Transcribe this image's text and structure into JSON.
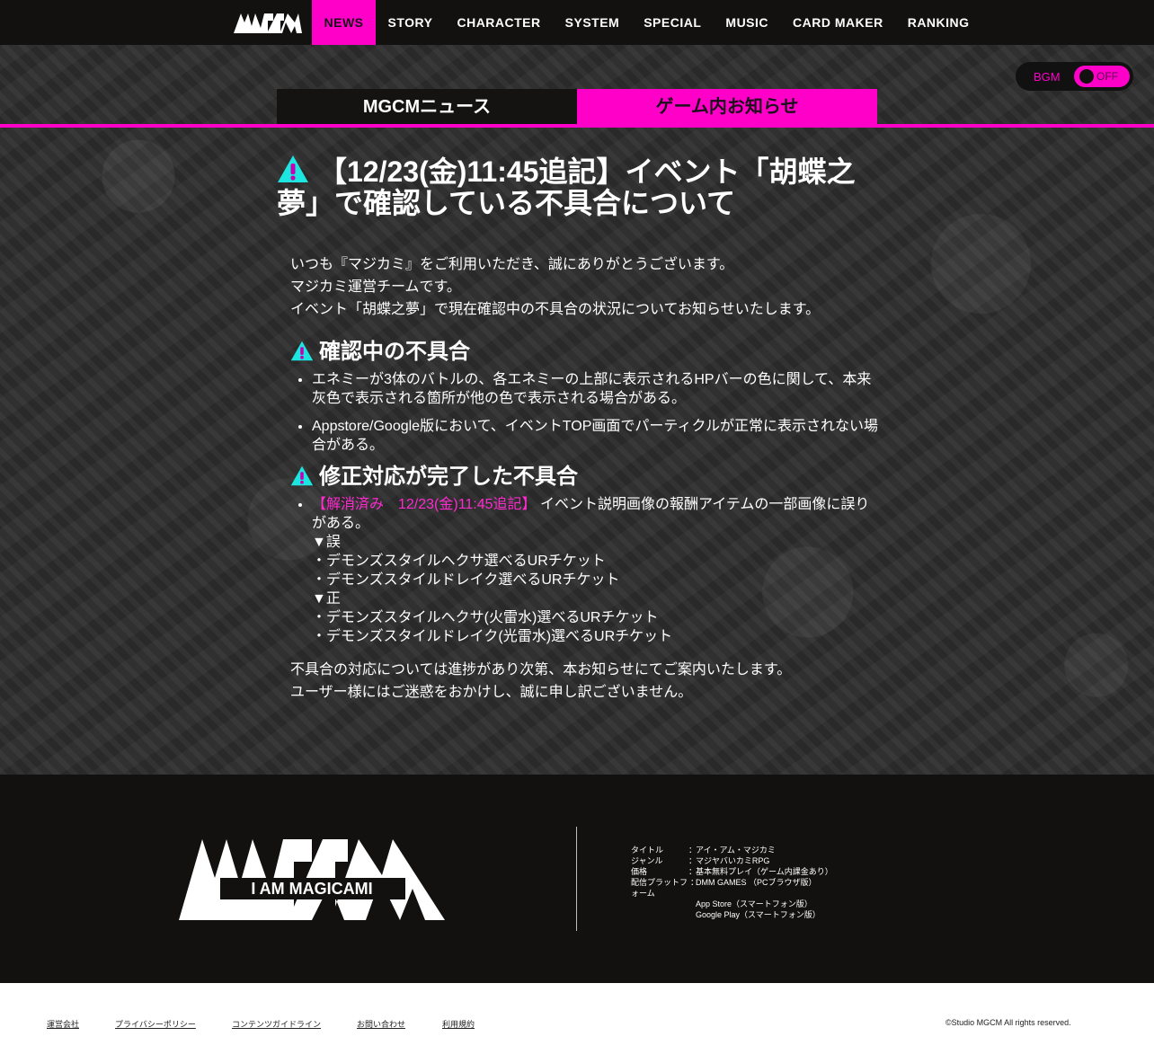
{
  "nav": {
    "items": [
      "NEWS",
      "STORY",
      "CHARACTER",
      "SYSTEM",
      "SPECIAL",
      "MUSIC",
      "CARD MAKER",
      "RANKING"
    ],
    "active": "NEWS"
  },
  "bgm": {
    "label": "BGM",
    "state": "OFF"
  },
  "tabs": {
    "news": "MGCMニュース",
    "info": "ゲーム内お知らせ"
  },
  "article": {
    "title": "【12/23(金)11:45追記】イベント「胡蝶之夢」で確認している不具合について",
    "intro": [
      "いつも『マジカミ』をご利用いただき、誠にありがとうございます。",
      "マジカミ運営チームです。",
      "イベント「胡蝶之夢」で現在確認中の不具合の状況についてお知らせいたします。"
    ],
    "section1": {
      "heading": "確認中の不具合",
      "items": [
        "エネミーが3体のバトルの、各エネミーの上部に表示されるHPバーの色に関して、本来灰色で表示される箇所が他の色で表示される場合がある。",
        "Appstore/Google版において、イベントTOP画面でパーティクルが正常に表示されない場合がある。"
      ]
    },
    "section2": {
      "heading": "修正対応が完了した不具合",
      "resolved_tag": "【解消済み　12/23(金)11:45追記】",
      "item_text": "イベント説明画像の報酬アイテムの一部画像に誤りがある。",
      "lines": [
        "▼誤",
        "・デモンズスタイルヘクサ選べるURチケット",
        "・デモンズスタイルドレイク選べるURチケット",
        "▼正",
        "・デモンズスタイルヘクサ(火雷水)選べるURチケット",
        "・デモンズスタイルドレイク(光雷水)選べるURチケット"
      ]
    },
    "closing": [
      "不具合の対応については進捗があり次第、本お知らせにてご案内いたします。",
      "ユーザー様にはご迷惑をおかけし、誠に申し訳ございません。"
    ]
  },
  "footer": {
    "logo_text": "I AM MAGICAMI",
    "info": [
      {
        "key": "タイトル",
        "sep": "：",
        "value": "アイ・アム・マジカミ"
      },
      {
        "key": "ジャンル",
        "sep": "：",
        "value": "マジヤバいカミRPG"
      },
      {
        "key": "価格",
        "sep": "：",
        "value": "基本無料プレイ（ゲーム内課金あり）"
      },
      {
        "key": "配信プラットフォーム",
        "sep": "：",
        "value": "DMM GAMES （PCブラウザ版）"
      },
      {
        "key": "",
        "sep": "",
        "value": "App Store（スマートフォン版）"
      },
      {
        "key": "",
        "sep": "",
        "value": "Google Play（スマートフォン版）"
      }
    ],
    "links": [
      "運営会社",
      "プライバシーポリシー",
      "コンテンツガイドライン",
      "お問い合わせ",
      "利用規約"
    ],
    "copyright": "©Studio MGCM All rights reserved."
  }
}
